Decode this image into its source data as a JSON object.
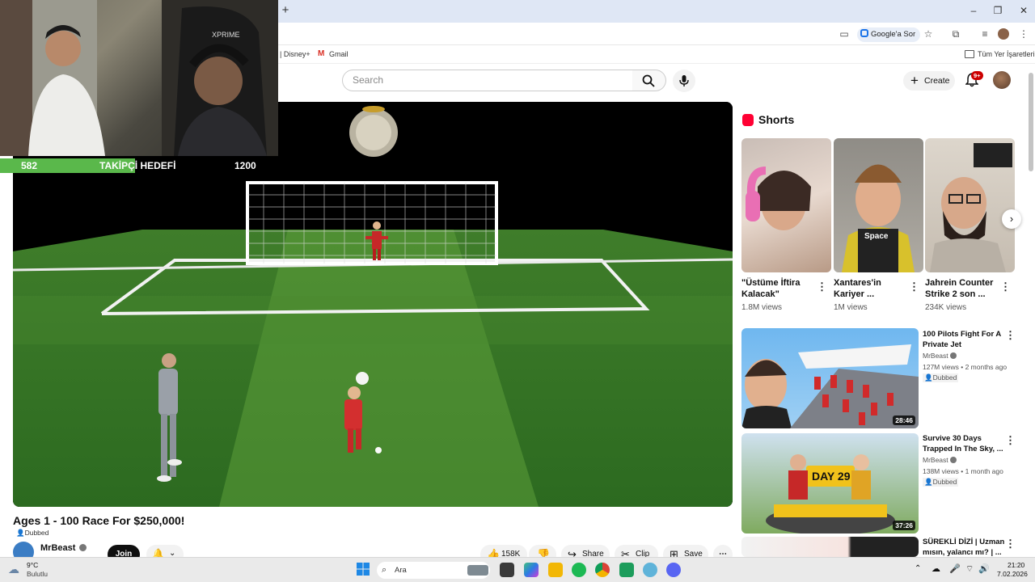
{
  "browser": {
    "new_tab_symbol": "+",
    "google_ask": "Google'a Sor",
    "bookmarks": [
      "| Disney+",
      "Gmail"
    ],
    "all_bookmarks": "Tüm Yer İşaretleri"
  },
  "stream_overlay": {
    "current": "582",
    "label": "TAKİPÇİ HEDEFİ",
    "target": "1200",
    "progress": 0.485
  },
  "youtube": {
    "search_placeholder": "Search",
    "create_label": "Create",
    "notifications_badge": "9+",
    "video": {
      "title": "Ages 1 - 100 Race For $250,000!",
      "dubbed": "Dubbed",
      "channel": "MrBeast",
      "join": "Join",
      "likes": "158K",
      "share": "Share",
      "clip": "Clip",
      "save": "Save"
    },
    "shorts_heading": "Shorts",
    "shorts": [
      {
        "title": "\"Üstüme İftira Kalacak\"",
        "views": "1.8M views"
      },
      {
        "title": "Xantares'in Kariyer ...",
        "views": "1M views",
        "overlay": "Space"
      },
      {
        "title": "Jahrein Counter Strike 2 son ...",
        "views": "234K views"
      }
    ],
    "recommendations": [
      {
        "title": "100 Pilots Fight For A Private Jet",
        "channel": "MrBeast",
        "meta": "127M views • 2 months ago",
        "badge": "Dubbed",
        "duration": "28:46"
      },
      {
        "title": "Survive 30 Days Trapped In The Sky, ...",
        "channel": "MrBeast",
        "meta": "138M views • 1 month ago",
        "badge": "Dubbed",
        "duration": "37:26",
        "overlay": "DAY 29"
      },
      {
        "title": "SÜREKLİ DİZİ | Uzman mısın, yalancı mı? | ...",
        "channel": "",
        "meta": "",
        "badge": "",
        "duration": ""
      }
    ]
  },
  "taskbar": {
    "weather_temp": "9°C",
    "weather_desc": "Bulutlu",
    "search_placeholder": "Ara",
    "time": "21:20",
    "date": "7.02.2026"
  }
}
